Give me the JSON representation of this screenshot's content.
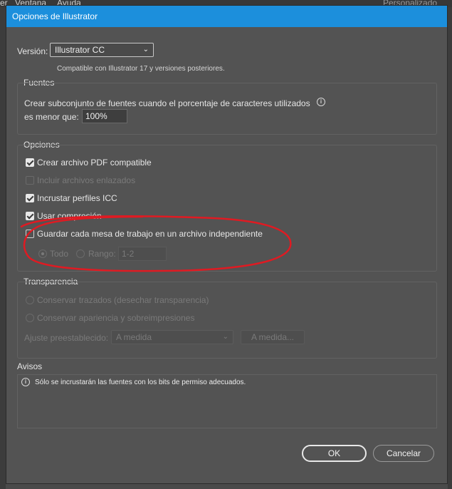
{
  "app_menu": {
    "items": [
      "er",
      "Ventana",
      "Ayuda"
    ],
    "right_label": "Personalizado"
  },
  "dialog": {
    "title": "Opciones de Illustrator"
  },
  "version": {
    "label": "Versión:",
    "selected": "Illustrator CC",
    "note": "Compatible con Illustrator 17 y versiones posteriores."
  },
  "fuentes": {
    "title": "Fuentes",
    "line1": "Crear subconjunto de fuentes cuando el porcentaje de caracteres utilizados",
    "line2": "es menor que:",
    "value": "100%"
  },
  "opciones": {
    "title": "Opciones",
    "items": [
      {
        "label": "Crear archivo PDF compatible",
        "checked": true,
        "enabled": true
      },
      {
        "label": "Incluir archivos enlazados",
        "checked": false,
        "enabled": false
      },
      {
        "label": "Incrustar perfiles ICC",
        "checked": true,
        "enabled": true
      },
      {
        "label": "Usar compresión",
        "checked": true,
        "enabled": true
      },
      {
        "label": "Guardar cada mesa de trabajo en un archivo independiente",
        "checked": false,
        "enabled": true
      }
    ],
    "todo_label": "Todo",
    "rango_label": "Rango:",
    "rango_value": "1-2"
  },
  "transparencia": {
    "title": "Transparencia",
    "option1": "Conservar trazados (desechar transparencia)",
    "option2": "Conservar apariencia y sobreimpresiones",
    "preset_label": "Ajuste preestablecido:",
    "preset_value": "A medida",
    "custom_button": "A medida..."
  },
  "avisos": {
    "title": "Avisos",
    "message": "Sólo se incrustarán las fuentes con los bits de permiso adecuados."
  },
  "buttons": {
    "ok": "OK",
    "cancel": "Cancelar"
  },
  "colors": {
    "titlebar": "#1c8fdc",
    "annotation": "#e01a22",
    "dialog_bg": "#535353"
  }
}
